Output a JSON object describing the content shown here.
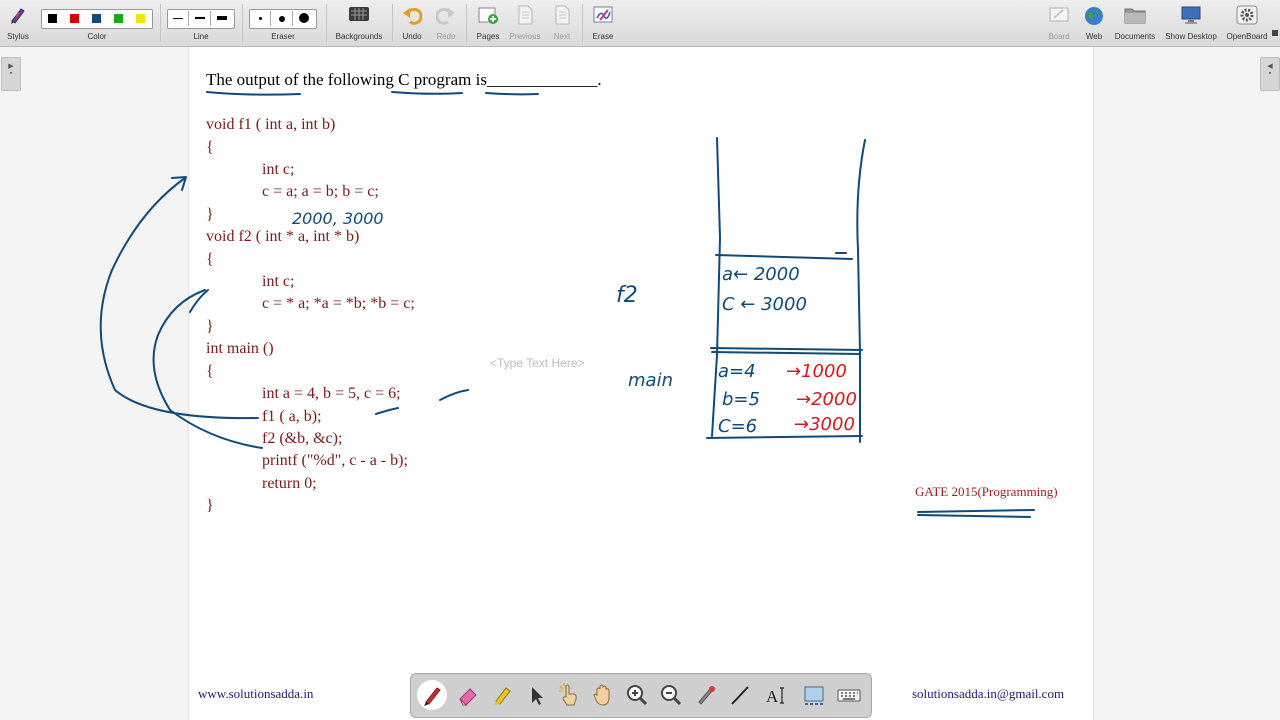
{
  "toolbar": {
    "left": [
      {
        "label": "Stylus",
        "icon": "stylus-icon"
      },
      {
        "label": "Color",
        "icon": "color-palette"
      },
      {
        "label": "Line",
        "icon": "line-width"
      },
      {
        "label": "Eraser",
        "icon": "eraser-size"
      },
      {
        "label": "Backgrounds",
        "icon": "backgrounds-icon"
      },
      {
        "label": "Undo",
        "icon": "undo-icon"
      },
      {
        "label": "Redo",
        "icon": "redo-icon"
      },
      {
        "label": "Pages",
        "icon": "pages-icon"
      },
      {
        "label": "Previous",
        "icon": "previous-icon"
      },
      {
        "label": "Next",
        "icon": "next-icon"
      },
      {
        "label": "Erase",
        "icon": "erase-icon"
      }
    ],
    "right": [
      {
        "label": "Board",
        "icon": "board-icon"
      },
      {
        "label": "Web",
        "icon": "web-globe-icon"
      },
      {
        "label": "Documents",
        "icon": "documents-folder-icon"
      },
      {
        "label": "Show Desktop",
        "icon": "show-desktop-icon"
      },
      {
        "label": "OpenBoard",
        "icon": "openboard-gear-icon"
      }
    ],
    "colors": [
      "#000000",
      "#d40000",
      "#14487a",
      "#18a818",
      "#f0e800"
    ]
  },
  "document": {
    "question": "The output of the following C program is_____________.",
    "code_lines": [
      "void f1 ( int a, int b)",
      "{",
      "int c;",
      "c = a; a = b; b = c;",
      "}",
      "void f2 ( int * a, int * b)",
      "{",
      "int c;",
      "c = * a; *a = *b; *b = c;",
      "}",
      "int main ()",
      "{",
      "int a = 4, b = 5, c = 6;",
      "f1  ( a, b);",
      "f2 (&b, &c);",
      "printf (\"%d\", c - a - b);",
      "return 0;",
      "}"
    ],
    "placeholder": "<Type Text Here>",
    "source_label": "GATE 2015(Programming)"
  },
  "annotations": {
    "values_note": "2000, 3000",
    "frame_f2": "f2",
    "frame_main": "main",
    "f2_rows": [
      "a← 2000",
      "C ← 3000"
    ],
    "main_rows": [
      "a=4",
      "b=5",
      "C=6"
    ],
    "main_addrs": [
      "→1000",
      "→2000",
      "→3000"
    ]
  },
  "footer": {
    "website": "www.solutionsadda.in",
    "email": "solutionsadda.in@gmail.com"
  },
  "bottom_tools": [
    {
      "name": "pen-tool-icon",
      "active": true
    },
    {
      "name": "eraser-tool-icon"
    },
    {
      "name": "marker-tool-icon"
    },
    {
      "name": "selector-arrow-icon"
    },
    {
      "name": "interact-hand-pointer-icon"
    },
    {
      "name": "pan-hand-icon"
    },
    {
      "name": "zoom-in-icon"
    },
    {
      "name": "zoom-out-icon"
    },
    {
      "name": "laser-pointer-icon"
    },
    {
      "name": "draw-line-icon"
    },
    {
      "name": "text-tool-icon"
    },
    {
      "name": "capture-icon"
    },
    {
      "name": "virtual-keyboard-icon"
    }
  ]
}
